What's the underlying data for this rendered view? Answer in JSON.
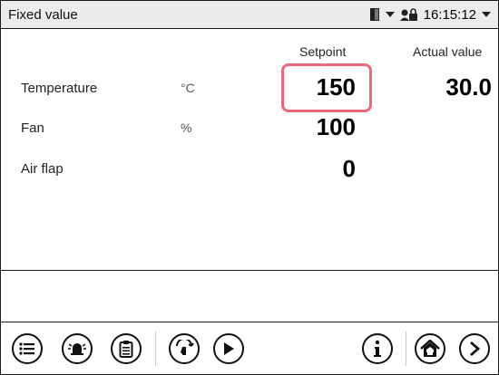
{
  "header": {
    "title": "Fixed value",
    "time": "16:15:12"
  },
  "columns": {
    "setpoint": "Setpoint",
    "actual": "Actual value"
  },
  "rows": [
    {
      "label": "Temperature",
      "unit": "°C",
      "setpoint": "150",
      "actual": "30.0"
    },
    {
      "label": "Fan",
      "unit": "%",
      "setpoint": "100",
      "actual": ""
    },
    {
      "label": "Air flap",
      "unit": "",
      "setpoint": "0",
      "actual": ""
    }
  ],
  "toolbar": {
    "icons": [
      "menu-icon",
      "alarm-icon",
      "clipboard-icon",
      "setpoint-entry-icon",
      "play-icon",
      "info-icon",
      "home-icon",
      "next-icon"
    ]
  },
  "colors": {
    "highlight": "#e8697a",
    "topbar": "#ececec"
  }
}
